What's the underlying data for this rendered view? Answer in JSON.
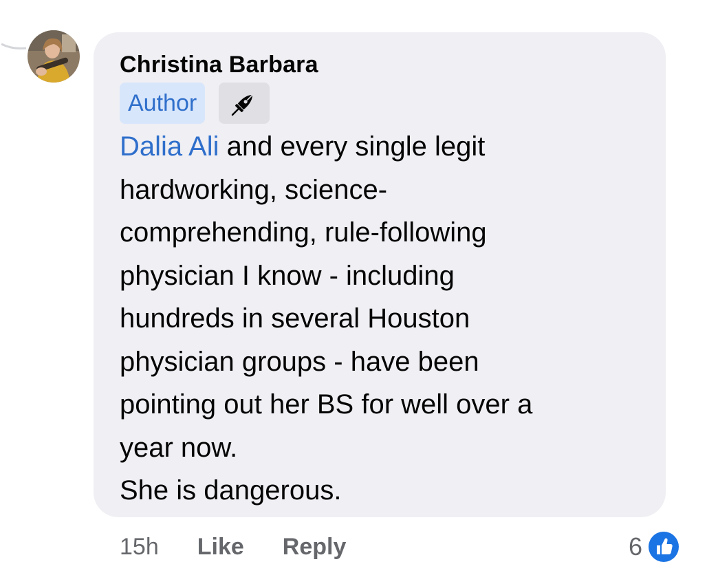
{
  "comment": {
    "author_name": "Christina Barbara",
    "author_badge": "Author",
    "badge_icon": "fountain-pen-icon",
    "avatar_icon": "profile-photo",
    "mention": "Dalia Ali",
    "text_lines": [
      " and every single legit",
      "hardworking, science-",
      "comprehending, rule-following",
      "physician I know - including",
      "hundreds in several Houston",
      "physician groups - have been",
      "pointing out her BS for well over a",
      "year now.",
      "She is dangerous."
    ]
  },
  "actions": {
    "time": "15h",
    "like_label": "Like",
    "reply_label": "Reply"
  },
  "reactions": {
    "count": "6",
    "icon": "thumbs-up-icon"
  },
  "colors": {
    "bubble": "#efeff4",
    "accent": "#2f6fcb",
    "badge_bg": "#d8e6fb",
    "secondary_text": "#65676b",
    "like_blue": "#1b74e4"
  }
}
